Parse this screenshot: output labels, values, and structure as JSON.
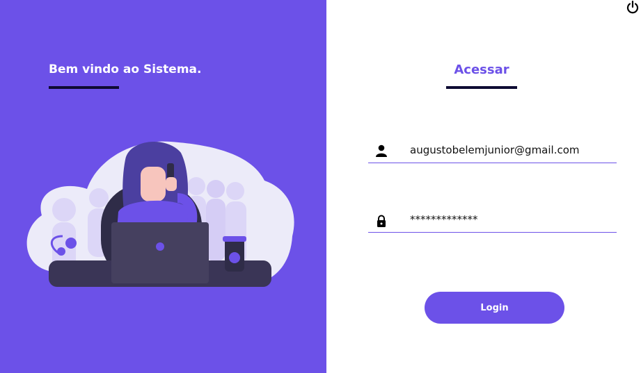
{
  "welcome": {
    "title": "Bem vindo ao Sistema."
  },
  "login": {
    "title": "Acessar",
    "email_value": "augustobelemjunior@gmail.com",
    "password_value": "*************",
    "button_label": "Login"
  },
  "icons": {
    "power": "power-icon",
    "user": "user-icon",
    "lock": "lock-icon"
  },
  "colors": {
    "accent": "#6c51e8",
    "dark": "#0e0b33"
  }
}
